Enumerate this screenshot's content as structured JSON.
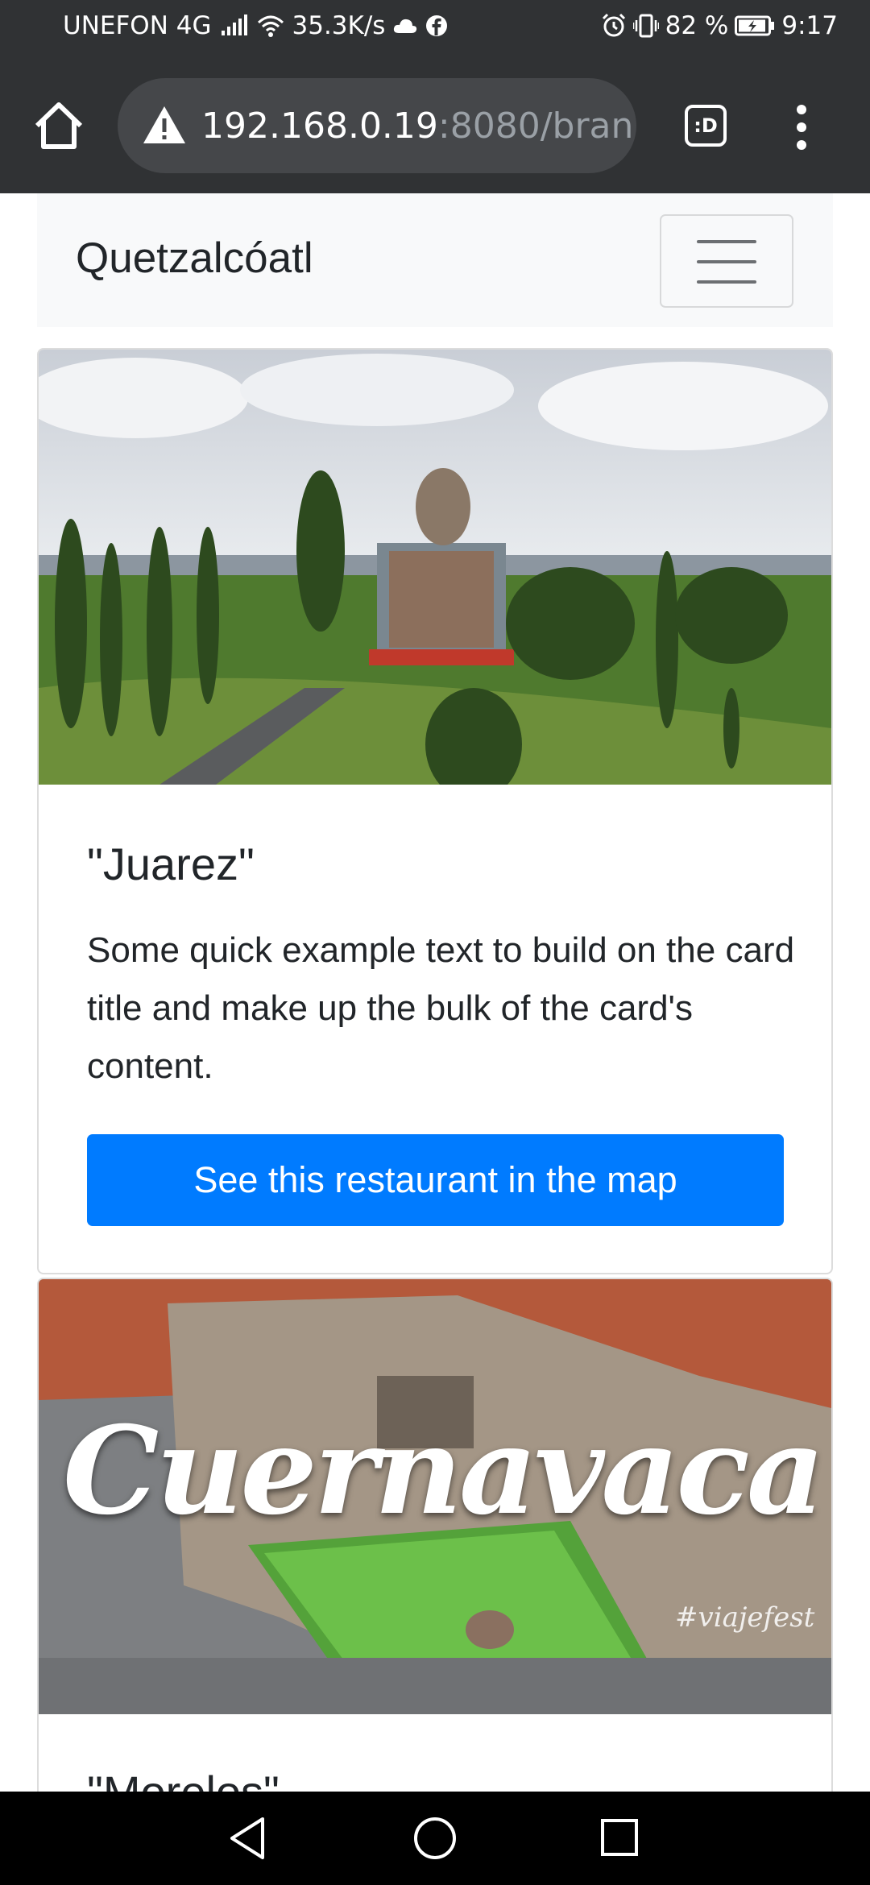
{
  "status_bar": {
    "carrier": "UNEFON 4G",
    "speed": "35.3K/s",
    "battery": "82 %",
    "time": "9:17"
  },
  "browser": {
    "url_host": "192.168.0.19",
    "url_rest": ":8080/bran",
    "tabs_label": ":D"
  },
  "navbar": {
    "brand": "Quetzalcóatl"
  },
  "cards": [
    {
      "title": "\"Juarez\"",
      "text": "Some quick example text to build on the card title and make up the bulk of the card's content.",
      "button": "See this restaurant in the map"
    },
    {
      "image_text": "Cuernavaca",
      "image_watermark": "#viajefest",
      "title": "\"Morelos\""
    }
  ],
  "colors": {
    "primary_button": "#007bff",
    "chrome_dark": "#303234"
  }
}
